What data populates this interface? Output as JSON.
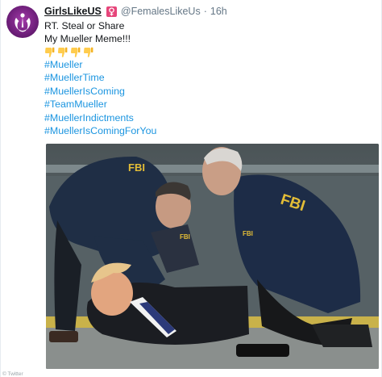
{
  "tweet": {
    "display_name": "GirlsLikeUS",
    "handle": "@FemalesLikeUs",
    "separator": "·",
    "time": "16h",
    "lines": [
      "RT. Steal or Share",
      "My Mueller Meme!!!"
    ],
    "emoji": [
      "thumbs-down-icon",
      "thumbs-down-icon",
      "thumbs-down-icon",
      "thumbs-down-icon"
    ],
    "hashtags": [
      "#Mueller",
      "#MuellerTime",
      "#MuellerIsComing",
      "#TeamMueller",
      "#MuellerIndictments",
      "#MuellerIsComingForYou"
    ],
    "media_jacket_text": [
      "FBI",
      "FBI",
      "FBI",
      "FBI"
    ]
  },
  "watermark": "© Twitter",
  "colors": {
    "link": "#1b95e0",
    "muted": "#657786",
    "badge": "#e6457a",
    "avatar": "#6e1f7a"
  }
}
